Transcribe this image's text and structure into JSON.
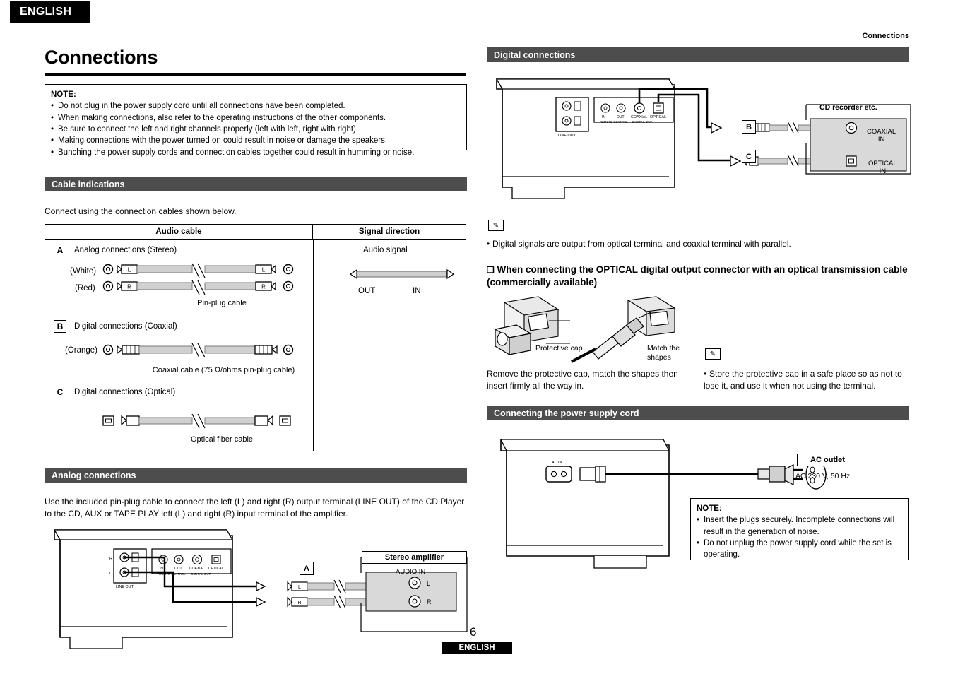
{
  "header": {
    "language_tab": "ENGLISH",
    "running_head": "Connections",
    "page_title": "Connections"
  },
  "note_top": {
    "title": "NOTE:",
    "items": [
      "Do not plug in the power supply cord until all connections have been completed.",
      "When making connections, also refer to the operating instructions of the other components.",
      "Be sure to connect the left and right channels properly (left with left, right with right).",
      "Making connections with the power turned on could result in noise or damage the speakers.",
      "Bunching the power supply cords and connection cables together could result in humming or noise."
    ]
  },
  "cable_indications": {
    "bar_label": "Cable indications",
    "intro": "Connect using the connection cables shown below.",
    "table": {
      "headers": [
        "Audio cable",
        "Signal direction"
      ],
      "signal": {
        "label": "Audio signal",
        "out": "OUT",
        "in": "IN"
      },
      "rows": [
        {
          "badge": "A",
          "title": "Analog connections (Stereo)",
          "left_labels": [
            "(White)",
            "(Red)"
          ],
          "plug_marks": [
            "L",
            "R",
            "L",
            "R"
          ],
          "caption": "Pin-plug cable"
        },
        {
          "badge": "B",
          "title": "Digital connections (Coaxial)",
          "left_labels": [
            "(Orange)"
          ],
          "caption": "Coaxial cable (75 Ω/ohms pin-plug cable)"
        },
        {
          "badge": "C",
          "title": "Digital connections (Optical)",
          "left_labels": [],
          "caption": "Optical fiber cable"
        }
      ]
    }
  },
  "analog_connections": {
    "bar_label": "Analog connections",
    "paragraph": "Use the included pin-plug cable to connect the left (L) and right (R) output terminal (LINE OUT) of the CD Player to the CD, AUX or TAPE PLAY left (L) and right (R) input terminal of the amplifier.",
    "badge": "A",
    "amp_title": "Stereo amplifier",
    "amp_audio_in": "AUDIO IN",
    "amp_channels": [
      "L",
      "R"
    ],
    "device_labels": {
      "line_out": "LINE OUT",
      "r": "R",
      "l": "L",
      "coaxial": "COAXIAL",
      "optical": "OPTICAL",
      "digital_out": "DIGITAL OUT",
      "remote_control": "REMOTE CONTROL",
      "in": "IN",
      "out": "OUT"
    }
  },
  "digital_connections": {
    "bar_label": "Digital connections",
    "badges": {
      "coaxial": "B",
      "optical": "C"
    },
    "recorder_title": "CD recorder etc.",
    "recorder_inputs": [
      {
        "line1": "COAXIAL",
        "line2": "IN"
      },
      {
        "line1": "OPTICAL",
        "line2": "IN"
      }
    ],
    "note": "Digital signals are output from optical terminal and coaxial terminal with parallel.",
    "optical_heading": "When connecting the OPTICAL digital output connector with an optical transmission cable (commercially available)",
    "cap_label": "Protective cap",
    "match_label": "Match the shapes",
    "instruction": "Remove the protective cap, match the shapes then insert firmly all the way in.",
    "store_note": "Store the protective cap in a safe place so as not to lose it, and use it when not using the terminal."
  },
  "power_supply": {
    "bar_label": "Connecting the power supply cord",
    "ac_in_label": "AC IN",
    "outlet_box": "AC outlet",
    "outlet_spec": "AC 230 V,  50 Hz",
    "note": {
      "title": "NOTE:",
      "items": [
        "Insert the plugs securely. Incomplete connections will result in the generation of noise.",
        "Do not unplug the power supply cord while the set is operating."
      ]
    }
  },
  "footer": {
    "page_number": "6",
    "language": "ENGLISH"
  }
}
